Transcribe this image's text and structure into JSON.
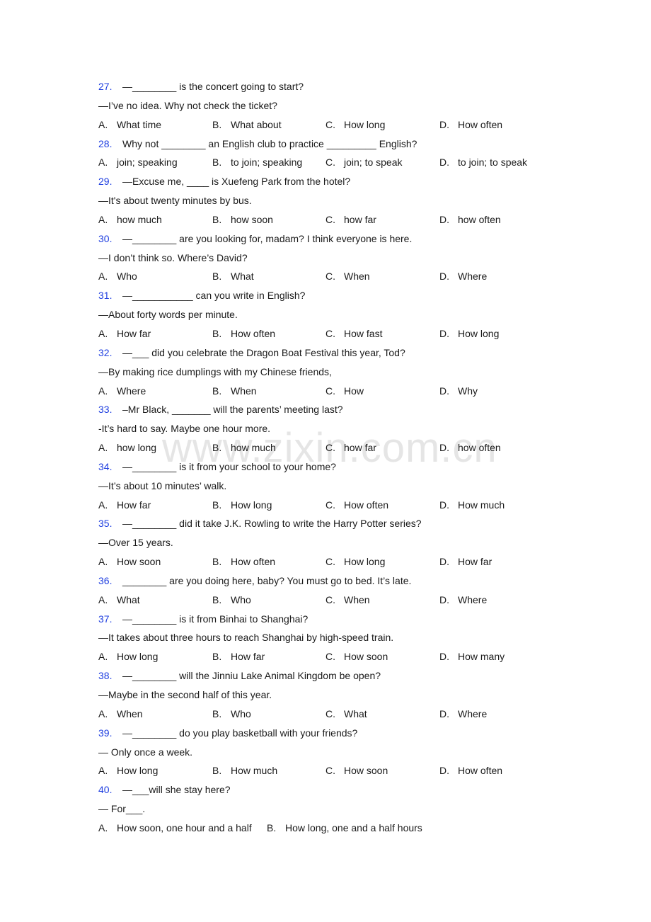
{
  "watermark": "www.zixin.com.cn",
  "questions": [
    {
      "number": "27.",
      "lines": [
        "—________ is the concert going to start?",
        "—I’ve no idea. Why not check the ticket?"
      ],
      "options": [
        {
          "letter": "A.",
          "text": "What time"
        },
        {
          "letter": "B.",
          "text": "What about"
        },
        {
          "letter": "C.",
          "text": "How long"
        },
        {
          "letter": "D.",
          "text": "How often"
        }
      ]
    },
    {
      "number": "28.",
      "lines": [
        "Why not ________ an English club to practice _________ English?"
      ],
      "options": [
        {
          "letter": "A.",
          "text": "join; speaking"
        },
        {
          "letter": "B.",
          "text": "to join; speaking"
        },
        {
          "letter": "C.",
          "text": "join; to speak"
        },
        {
          "letter": "D.",
          "text": "to join; to speak"
        }
      ]
    },
    {
      "number": "29.",
      "lines": [
        "—Excuse me, ____ is Xuefeng Park from the hotel?",
        "—It's about twenty minutes by bus."
      ],
      "options": [
        {
          "letter": "A.",
          "text": "how much"
        },
        {
          "letter": "B.",
          "text": "how soon"
        },
        {
          "letter": "C.",
          "text": "how far"
        },
        {
          "letter": "D.",
          "text": "how often"
        }
      ]
    },
    {
      "number": "30.",
      "lines": [
        "—________ are you looking for, madam? I think everyone is here.",
        "—I don’t think so. Where’s David?"
      ],
      "options": [
        {
          "letter": "A.",
          "text": "Who"
        },
        {
          "letter": "B.",
          "text": "What"
        },
        {
          "letter": "C.",
          "text": "When"
        },
        {
          "letter": "D.",
          "text": "Where"
        }
      ]
    },
    {
      "number": "31.",
      "lines": [
        "—___________ can you write in English?",
        "—About forty words per minute."
      ],
      "options": [
        {
          "letter": "A.",
          "text": "How far"
        },
        {
          "letter": "B.",
          "text": "How often"
        },
        {
          "letter": "C.",
          "text": "How fast"
        },
        {
          "letter": "D.",
          "text": "How long"
        }
      ]
    },
    {
      "number": "32.",
      "lines": [
        "—___ did you celebrate the Dragon Boat Festival this year, Tod?",
        "—By making rice dumplings with my Chinese friends,"
      ],
      "options": [
        {
          "letter": "A.",
          "text": "Where"
        },
        {
          "letter": "B.",
          "text": "When"
        },
        {
          "letter": "C.",
          "text": "How"
        },
        {
          "letter": "D.",
          "text": "Why"
        }
      ]
    },
    {
      "number": "33.",
      "lines": [
        "–Mr Black, _______ will the parents’ meeting last?",
        "-It’s hard to say. Maybe one hour more."
      ],
      "options": [
        {
          "letter": "A.",
          "text": "how long"
        },
        {
          "letter": "B.",
          "text": "how much"
        },
        {
          "letter": "C.",
          "text": "how far"
        },
        {
          "letter": "D.",
          "text": "how often"
        }
      ]
    },
    {
      "number": "34.",
      "lines": [
        "—________ is it from your school to your home?",
        "—It’s about 10 minutes’ walk."
      ],
      "options": [
        {
          "letter": "A.",
          "text": "How far"
        },
        {
          "letter": "B.",
          "text": "How long"
        },
        {
          "letter": "C.",
          "text": "How often"
        },
        {
          "letter": "D.",
          "text": "How much"
        }
      ]
    },
    {
      "number": "35.",
      "lines": [
        "—________ did it take J.K. Rowling to write the Harry Potter series?",
        "—Over 15 years."
      ],
      "options": [
        {
          "letter": "A.",
          "text": "How soon"
        },
        {
          "letter": "B.",
          "text": "How often"
        },
        {
          "letter": "C.",
          "text": "How long"
        },
        {
          "letter": "D.",
          "text": "How far"
        }
      ]
    },
    {
      "number": "36.",
      "lines": [
        "________ are you doing here, baby? You must go to bed. It’s late."
      ],
      "options": [
        {
          "letter": "A.",
          "text": "What"
        },
        {
          "letter": "B.",
          "text": "Who"
        },
        {
          "letter": "C.",
          "text": "When"
        },
        {
          "letter": "D.",
          "text": "Where"
        }
      ]
    },
    {
      "number": "37.",
      "lines": [
        "—________ is it from Binhai to Shanghai?",
        "—It takes about three hours to reach Shanghai by high-speed train."
      ],
      "options": [
        {
          "letter": "A.",
          "text": "How long"
        },
        {
          "letter": "B.",
          "text": "How far"
        },
        {
          "letter": "C.",
          "text": "How soon"
        },
        {
          "letter": "D.",
          "text": "How many"
        }
      ]
    },
    {
      "number": "38.",
      "lines": [
        "—________ will the Jinniu Lake Animal Kingdom be open?",
        "—Maybe in the second half of this year."
      ],
      "options": [
        {
          "letter": "A.",
          "text": "When"
        },
        {
          "letter": "B.",
          "text": "Who"
        },
        {
          "letter": "C.",
          "text": "What"
        },
        {
          "letter": "D.",
          "text": "Where"
        }
      ]
    },
    {
      "number": "39.",
      "lines": [
        "—________ do you play basketball with your friends?",
        "— Only once a week."
      ],
      "options": [
        {
          "letter": "A.",
          "text": "How long"
        },
        {
          "letter": "B.",
          "text": "How much"
        },
        {
          "letter": "C.",
          "text": "How soon"
        },
        {
          "letter": "D.",
          "text": "How often"
        }
      ]
    },
    {
      "number": "40.",
      "lines": [
        "—___will she stay here?",
        "— For___."
      ],
      "options": [
        {
          "letter": "A.",
          "text": "How soon, one hour and a half"
        },
        {
          "letter": "B.",
          "text": "How long, one and a half hours"
        }
      ]
    }
  ]
}
